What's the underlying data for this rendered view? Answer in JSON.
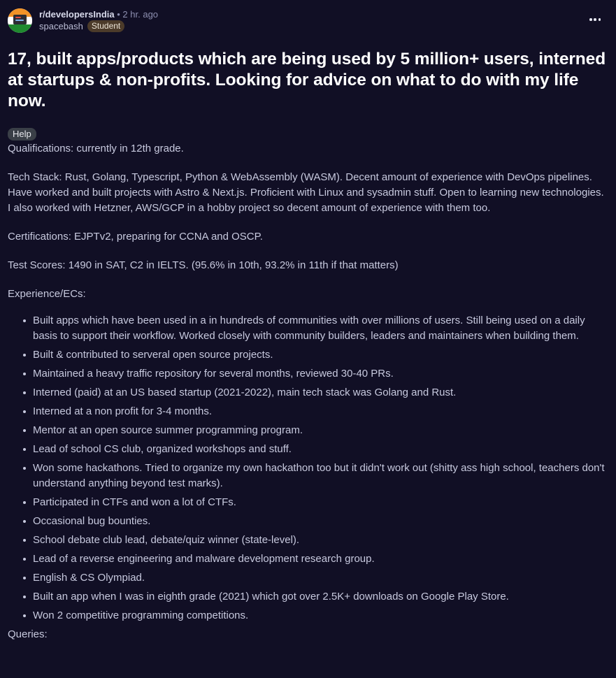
{
  "header": {
    "subreddit": "r/developersIndia",
    "time": " • 2 hr. ago",
    "author": "spacebash",
    "flair": "Student"
  },
  "post": {
    "title": "17, built apps/products which are being used by 5 million+ users, interned at startups & non-profits. Looking for advice on what to do with my life now.",
    "flair": "Help",
    "qualifications": "Qualifications: currently in 12th grade.",
    "tech_stack": "Tech Stack: Rust, Golang, Typescript, Python & WebAssembly (WASM). Decent amount of experience with DevOps pipelines. Have worked and built projects with Astro & Next.js. Proficient with Linux and sysadmin stuff. Open to learning new technologies. I also worked with Hetzner, AWS/GCP in a hobby project so decent amount of experience with them too.",
    "certifications": "Certifications: EJPTv2, preparing for CCNA and OSCP.",
    "test_scores": "Test Scores: 1490 in SAT, C2 in IELTS. (95.6% in 10th, 93.2% in 11th if that matters)",
    "experience_heading": "Experience/ECs:",
    "experience": [
      "Built apps which have been used in a in hundreds of communities with over millions of users. Still being used on a daily basis to support their workflow. Worked closely with community builders, leaders and maintainers when building them.",
      "Built & contributed to serveral open source projects.",
      "Maintained a heavy traffic repository for several months, reviewed 30-40 PRs.",
      "Interned (paid) at an US based startup (2021-2022), main tech stack was Golang and Rust.",
      "Interned at a non profit for 3-4 months.",
      "Mentor at an open source summer programming program.",
      "Lead of school CS club, organized workshops and stuff.",
      "Won some hackathons. Tried to organize my own hackathon too but it didn't work out (shitty ass high school, teachers don't understand anything beyond test marks).",
      "Participated in CTFs and won a lot of CTFs.",
      "Occasional bug bounties.",
      "School debate club lead, debate/quiz winner (state-level).",
      "Lead of a reverse engineering and malware development research group.",
      "English & CS Olympiad.",
      "Built an app when I was in eighth grade (2021) which got over 2.5K+ downloads on Google Play Store.",
      "Won 2 competitive programming competitions."
    ],
    "queries_heading": "Queries:"
  },
  "colors": {
    "background": "#110f25",
    "flair_student_bg": "#4c3b2a",
    "flair_help_bg": "#3a3f47"
  },
  "icons": {
    "more": "more-options-icon",
    "avatar": "subreddit-avatar"
  }
}
